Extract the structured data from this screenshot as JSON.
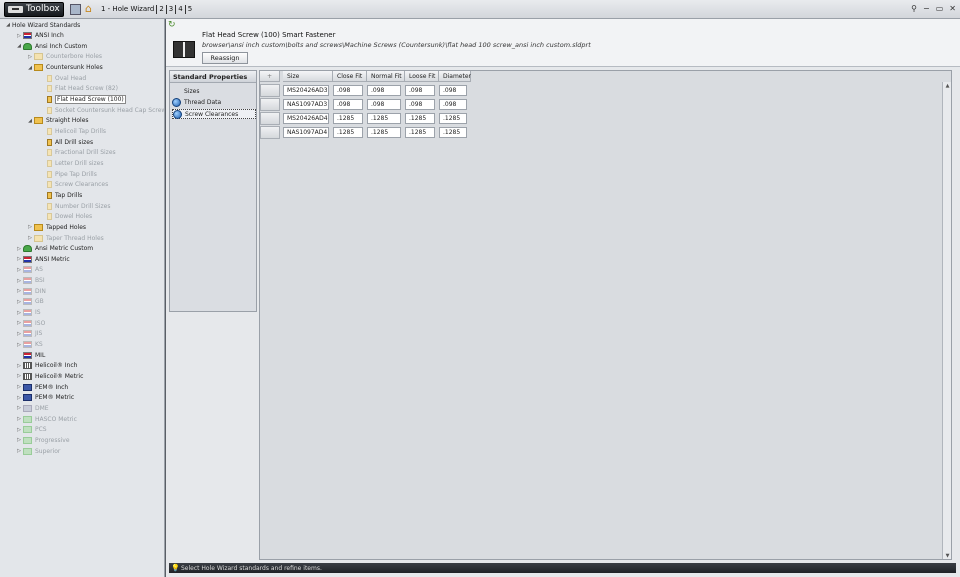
{
  "app": {
    "title": "Toolbox",
    "tabs": [
      "1 - Hole Wizard",
      "2",
      "3",
      "4",
      "5"
    ],
    "window_controls": [
      "pin",
      "minimize",
      "restore",
      "close"
    ]
  },
  "tree": {
    "items": [
      {
        "label": "Hole Wizard Standards",
        "expander": "expanded",
        "icon": "none",
        "dim": false
      },
      {
        "label": "ANSI Inch",
        "expander": "collapsed",
        "icon": "flag",
        "dim": false
      },
      {
        "label": "Ansi Inch Custom",
        "expander": "expanded",
        "icon": "person",
        "dim": false
      },
      {
        "label": "Counterbore Holes",
        "expander": "collapsed",
        "icon": "folder",
        "dim": true
      },
      {
        "label": "Countersunk Holes",
        "expander": "expanded",
        "icon": "folder",
        "dim": false
      },
      {
        "label": "Oval Head",
        "expander": "none",
        "icon": "hole",
        "dim": true
      },
      {
        "label": "Flat Head Screw (82)",
        "expander": "none",
        "icon": "hole",
        "dim": true
      },
      {
        "label": "Flat Head Screw (100)",
        "expander": "none",
        "icon": "hole",
        "dim": false,
        "selected": true
      },
      {
        "label": "Socket Countersunk Head Cap Screw",
        "expander": "none",
        "icon": "hole",
        "dim": true
      },
      {
        "label": "Straight Holes",
        "expander": "expanded",
        "icon": "folder",
        "dim": false
      },
      {
        "label": "Helicoil Tap Drills",
        "expander": "none",
        "icon": "hole",
        "dim": true
      },
      {
        "label": "All Drill sizes",
        "expander": "none",
        "icon": "hole",
        "dim": false
      },
      {
        "label": "Fractional Drill Sizes",
        "expander": "none",
        "icon": "hole",
        "dim": true
      },
      {
        "label": "Letter Drill sizes",
        "expander": "none",
        "icon": "hole",
        "dim": true
      },
      {
        "label": "Pipe Tap Drills",
        "expander": "none",
        "icon": "hole",
        "dim": true
      },
      {
        "label": "Screw Clearances",
        "expander": "none",
        "icon": "hole",
        "dim": true
      },
      {
        "label": "Tap Drills",
        "expander": "none",
        "icon": "hole",
        "dim": false
      },
      {
        "label": "Number Drill Sizes",
        "expander": "none",
        "icon": "hole",
        "dim": true
      },
      {
        "label": "Dowel Holes",
        "expander": "none",
        "icon": "hole",
        "dim": true
      },
      {
        "label": "Tapped Holes",
        "expander": "collapsed",
        "icon": "folder",
        "dim": false
      },
      {
        "label": "Taper Thread Holes",
        "expander": "collapsed",
        "icon": "folder",
        "dim": true
      },
      {
        "label": "Ansi Metric Custom",
        "expander": "collapsed",
        "icon": "person",
        "dim": false
      },
      {
        "label": "ANSI Metric",
        "expander": "collapsed",
        "icon": "flag",
        "dim": false
      },
      {
        "label": "AS",
        "expander": "collapsed",
        "icon": "flag",
        "dim": true
      },
      {
        "label": "BSI",
        "expander": "collapsed",
        "icon": "flag",
        "dim": true
      },
      {
        "label": "DIN",
        "expander": "collapsed",
        "icon": "flag",
        "dim": true
      },
      {
        "label": "GB",
        "expander": "collapsed",
        "icon": "flag",
        "dim": true
      },
      {
        "label": "IS",
        "expander": "collapsed",
        "icon": "flag",
        "dim": true
      },
      {
        "label": "ISO",
        "expander": "collapsed",
        "icon": "flag",
        "dim": true
      },
      {
        "label": "JIS",
        "expander": "collapsed",
        "icon": "flag",
        "dim": true
      },
      {
        "label": "KS",
        "expander": "collapsed",
        "icon": "flag",
        "dim": true
      },
      {
        "label": "MIL",
        "expander": "none",
        "icon": "flag",
        "dim": false
      },
      {
        "label": "Helicoil® Inch",
        "expander": "collapsed",
        "icon": "helicoil",
        "dim": false
      },
      {
        "label": "Helicoil® Metric",
        "expander": "collapsed",
        "icon": "helicoil",
        "dim": false
      },
      {
        "label": "PEM® Inch",
        "expander": "collapsed",
        "icon": "brand",
        "dim": false
      },
      {
        "label": "PEM® Metric",
        "expander": "collapsed",
        "icon": "brand",
        "dim": false
      },
      {
        "label": "DME",
        "expander": "collapsed",
        "icon": "brand",
        "dim": true
      },
      {
        "label": "HASCO Metric",
        "expander": "collapsed",
        "icon": "green",
        "dim": true
      },
      {
        "label": "PCS",
        "expander": "collapsed",
        "icon": "green",
        "dim": true
      },
      {
        "label": "Progressive",
        "expander": "collapsed",
        "icon": "green",
        "dim": true
      },
      {
        "label": "Superior",
        "expander": "collapsed",
        "icon": "green",
        "dim": true
      }
    ]
  },
  "header": {
    "title": "Flat Head Screw (100) Smart Fastener",
    "path": "browser\\ansi inch custom\\bolts and screws\\Machine Screws (Countersunk)\\flat head 100 screw_ansi inch custom.sldprt",
    "reassign_label": "Reassign"
  },
  "standard_properties": {
    "title": "Standard Properties",
    "items": [
      {
        "label": "Sizes",
        "icon": false,
        "active": false
      },
      {
        "label": "Thread Data",
        "icon": true,
        "active": false
      },
      {
        "label": "Screw Clearances",
        "icon": true,
        "active": true
      }
    ]
  },
  "grid": {
    "add_icon": "+",
    "columns": [
      "Size",
      "Close Fit",
      "Normal Fit",
      "Loose Fit",
      "Diameter"
    ],
    "rows": [
      [
        "MS20426AD3",
        ".098",
        ".098",
        ".098",
        ".098"
      ],
      [
        "NAS1097AD3",
        ".098",
        ".098",
        ".098",
        ".098"
      ],
      [
        "MS20426AD4",
        ".1285",
        ".1285",
        ".1285",
        ".1285"
      ],
      [
        "NAS1097AD4",
        ".1285",
        ".1285",
        ".1285",
        ".1285"
      ]
    ]
  },
  "status": {
    "text": "Select Hole Wizard standards and refine items."
  }
}
